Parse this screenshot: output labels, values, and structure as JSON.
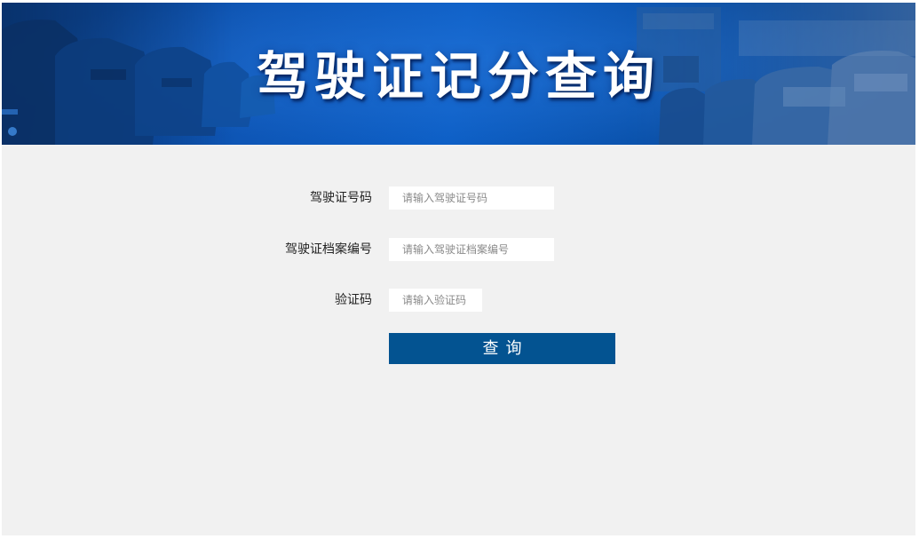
{
  "banner": {
    "title": "驾驶证记分查询"
  },
  "form": {
    "license_number": {
      "label": "驾驶证号码",
      "placeholder": "请输入驾驶证号码",
      "value": ""
    },
    "file_number": {
      "label": "驾驶证档案编号",
      "placeholder": "请输入驾驶证档案编号",
      "value": ""
    },
    "captcha": {
      "label": "验证码",
      "placeholder": "请输入验证码",
      "value": ""
    },
    "submit_label": "查询"
  },
  "colors": {
    "button": "#035391",
    "background": "#f1f1f1",
    "banner": "#0d5fc6"
  }
}
